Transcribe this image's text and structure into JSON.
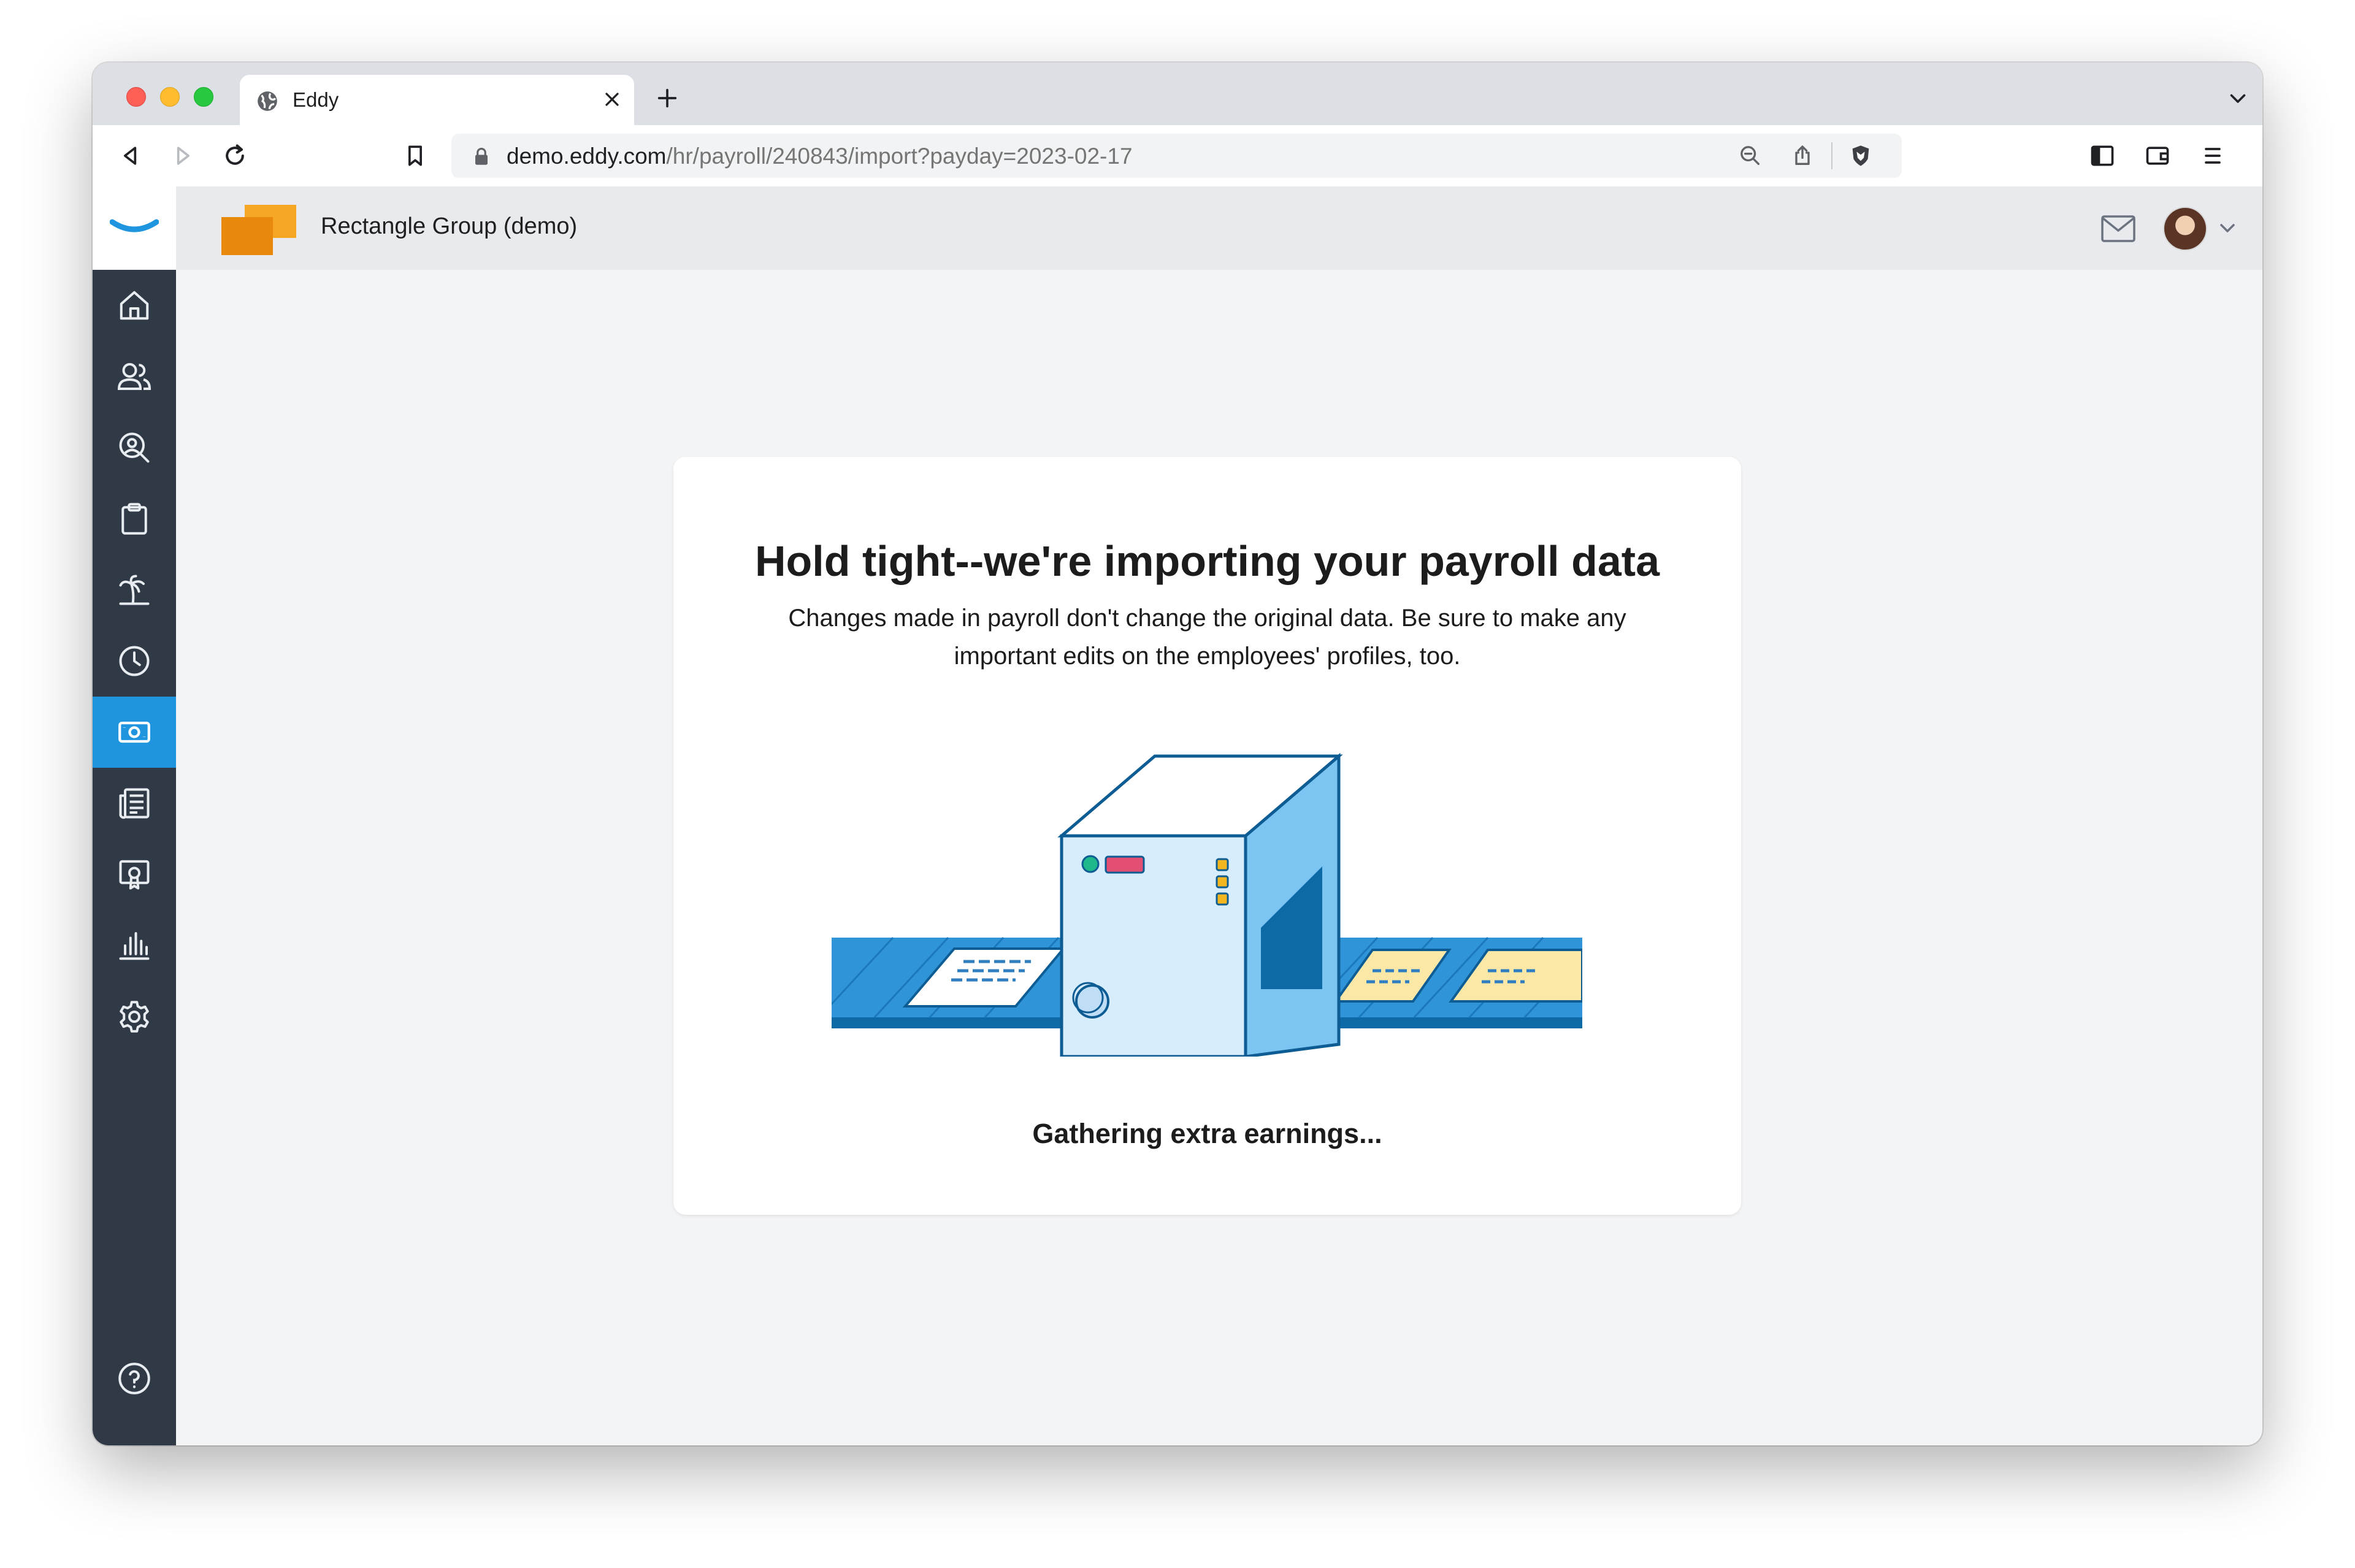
{
  "browser": {
    "tab_title": "Eddy",
    "url_host": "demo.eddy.com",
    "url_path": "/hr/payroll/240843/import?payday=2023-02-17"
  },
  "header": {
    "company_name": "Rectangle Group (demo)",
    "brand_color": "#1f95e0"
  },
  "sidebar": {
    "items": [
      {
        "icon": "home-icon"
      },
      {
        "icon": "people-icon"
      },
      {
        "icon": "person-search-icon"
      },
      {
        "icon": "clipboard-icon"
      },
      {
        "icon": "palm-tree-icon"
      },
      {
        "icon": "clock-icon"
      },
      {
        "icon": "payroll-money-icon",
        "active": true
      },
      {
        "icon": "news-icon"
      },
      {
        "icon": "certificate-icon"
      },
      {
        "icon": "reports-icon"
      },
      {
        "icon": "gear-icon"
      }
    ],
    "help_icon": "help-icon",
    "active_color": "#1f95e0",
    "background_color": "#2f3a46"
  },
  "main": {
    "title": "Hold tight--we're importing your payroll data",
    "description": "Changes made in payroll don't change the original data. Be sure to make any important edits on the employees' profiles, too.",
    "status": "Gathering extra earnings..."
  }
}
